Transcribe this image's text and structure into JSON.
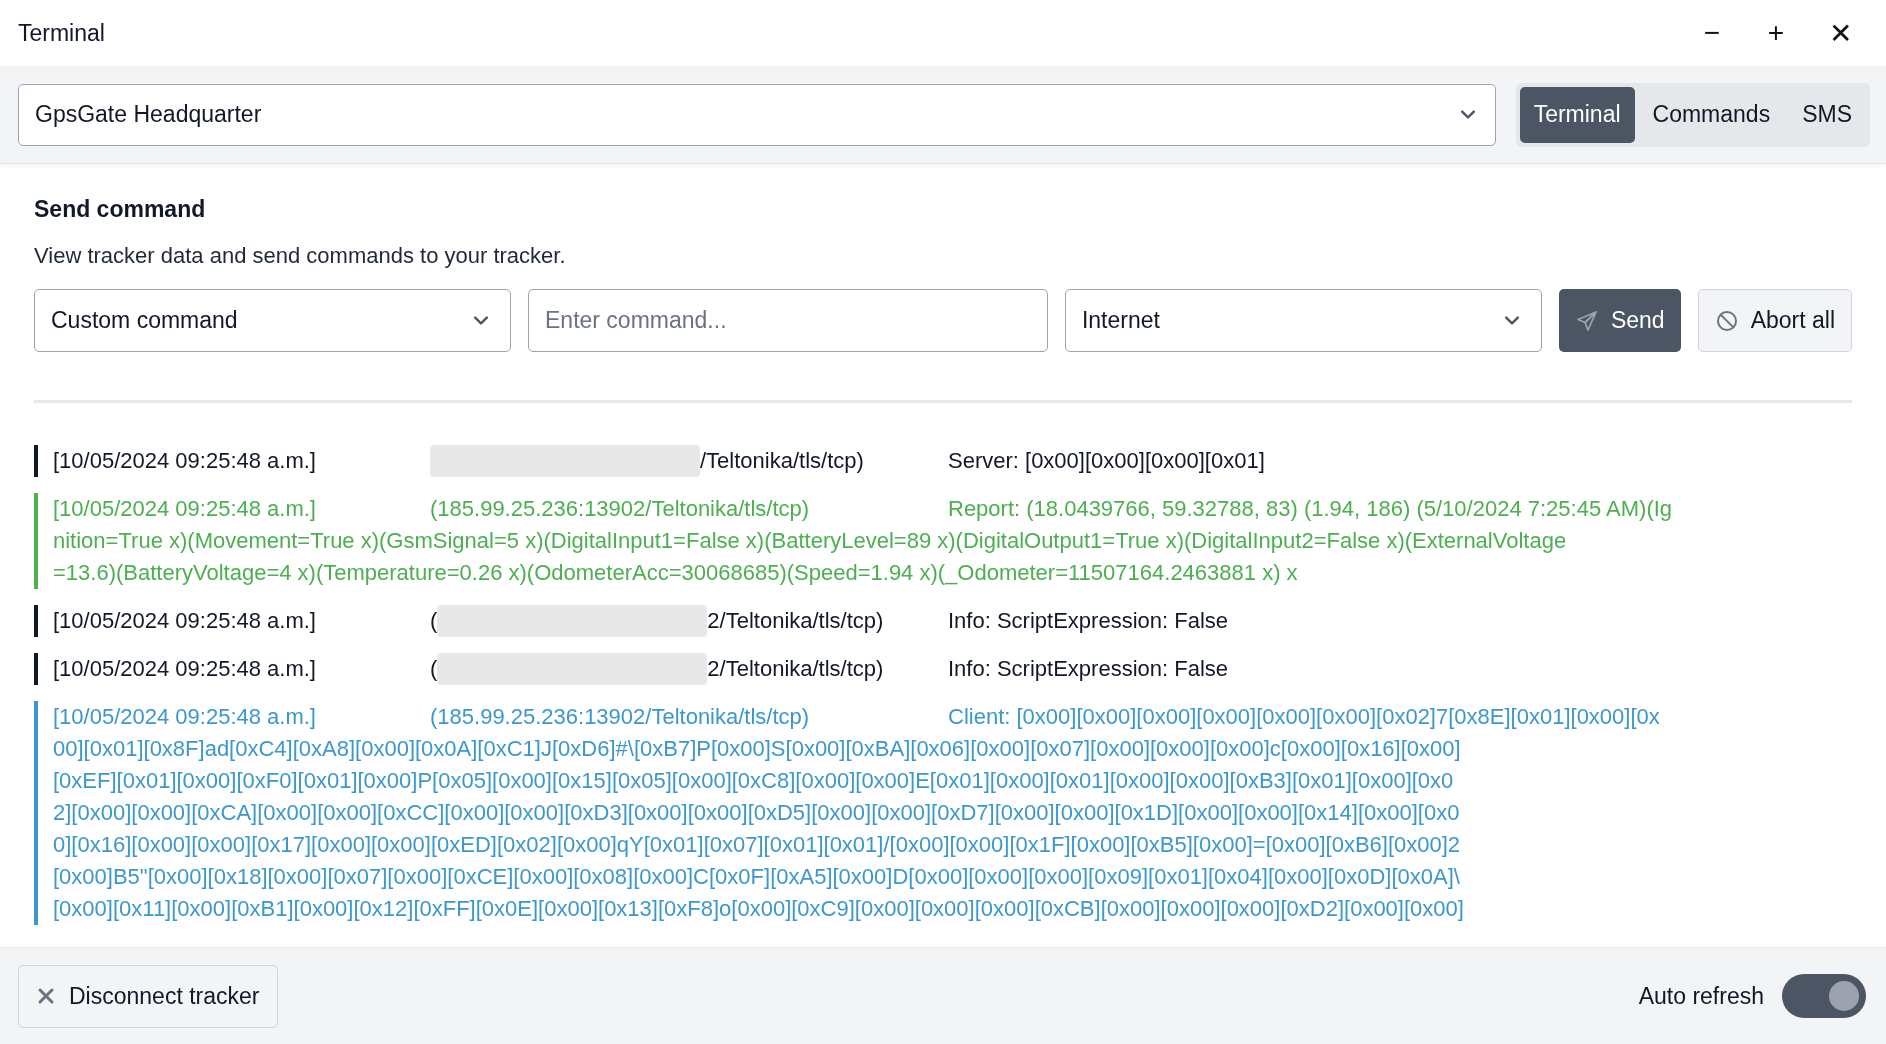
{
  "window": {
    "title": "Terminal",
    "controls": [
      "−",
      "+",
      "✕"
    ]
  },
  "header": {
    "device": "GpsGate Headquarter",
    "tabs": [
      {
        "label": "Terminal",
        "selected": true
      },
      {
        "label": "Commands",
        "selected": false
      },
      {
        "label": "SMS",
        "selected": false
      }
    ]
  },
  "send_command": {
    "heading": "Send command",
    "description": "View tracker data and send commands to your tracker.",
    "command_type": "Custom command",
    "command": {
      "placeholder": "Enter command..."
    },
    "channel": "Internet",
    "send_button": "Send",
    "abort_button": "Abort all"
  },
  "log": [
    {
      "kind": "info",
      "timestamp": "[10/05/2024 09:25:48 a.m.]",
      "redacted": true,
      "address": "/Teltonika/tls/tcp)",
      "message_lines": [
        "Server: [0x00][0x00][0x00][0x01]"
      ]
    },
    {
      "kind": "report",
      "timestamp": "[10/05/2024 09:25:48 a.m.]",
      "redacted": false,
      "address": "(185.99.25.236:13902/Teltonika/tls/tcp)",
      "message_lines": [
        "Report: (18.0439766, 59.32788, 83) (1.94, 186) (5/10/2024 7:25:45 AM)(Ig",
        "nition=True x)(Movement=True x)(GsmSignal=5 x)(DigitalInput1=False x)(BatteryLevel=89 x)(DigitalOutput1=True x)(DigitalInput2=False x)(ExternalVoltage",
        "=13.6)(BatteryVoltage=4 x)(Temperature=0.26 x)(OdometerAcc=30068685)(Speed=1.94 x)(_Odometer=11507164.2463881 x) x"
      ]
    },
    {
      "kind": "info",
      "timestamp": "[10/05/2024 09:25:48 a.m.]",
      "redacted": true,
      "address_prefix": "(",
      "address": "2/Teltonika/tls/tcp)",
      "message_lines": [
        "Info: ScriptExpression: False"
      ]
    },
    {
      "kind": "info",
      "timestamp": "[10/05/2024 09:25:48 a.m.]",
      "redacted": true,
      "address_prefix": "(",
      "address": "2/Teltonika/tls/tcp)",
      "message_lines": [
        "Info: ScriptExpression: False"
      ]
    },
    {
      "kind": "client",
      "timestamp": "[10/05/2024 09:25:48 a.m.]",
      "redacted": false,
      "address": "(185.99.25.236:13902/Teltonika/tls/tcp)",
      "message_lines": [
        "Client: [0x00][0x00][0x00][0x00][0x00][0x00][0x02]7[0x8E][0x01][0x00][0x",
        "00][0x01][0x8F]ad[0xC4][0xA8][0x00][0x0A][0xC1]J[0xD6]#\\[0xB7]P[0x00]S[0x00][0xBA][0x06][0x00][0x07][0x00][0x00][0x00]c[0x00][0x16][0x00]",
        "[0xEF][0x01][0x00][0xF0][0x01][0x00]P[0x05][0x00][0x15][0x05][0x00][0xC8][0x00][0x00]E[0x01][0x00][0x01][0x00][0x00][0xB3][0x01][0x00][0x0",
        "2][0x00][0x00][0xCA][0x00][0x00][0xCC][0x00][0x00][0xD3][0x00][0x00][0xD5][0x00][0x00][0xD7][0x00][0x00][0x1D][0x00][0x00][0x14][0x00][0x0",
        "0][0x16][0x00][0x00][0x17][0x00][0x00][0xED][0x02][0x00]qY[0x01][0x07][0x01][0x01]/[0x00][0x00][0x1F][0x00][0xB5][0x00]=[0x00][0xB6][0x00]2",
        "[0x00]B5\"[0x00][0x18][0x00][0x07][0x00][0xCE][0x00][0x08][0x00]C[0x0F][0xA5][0x00]D[0x00][0x00][0x00][0x09][0x01][0x04][0x00][0x0D][0x0A]\\",
        "[0x00][0x11][0x00][0xB1][0x00][0x12][0xFF][0x0E][0x00][0x13][0xF8]o[0x00][0xC9][0x00][0x00][0x00][0xCB][0x00][0x00][0x00][0xD2][0x00][0x00]"
      ]
    }
  ],
  "footer": {
    "disconnect_button": "Disconnect tracker",
    "auto_refresh": {
      "label": "Auto refresh",
      "on": true
    }
  }
}
